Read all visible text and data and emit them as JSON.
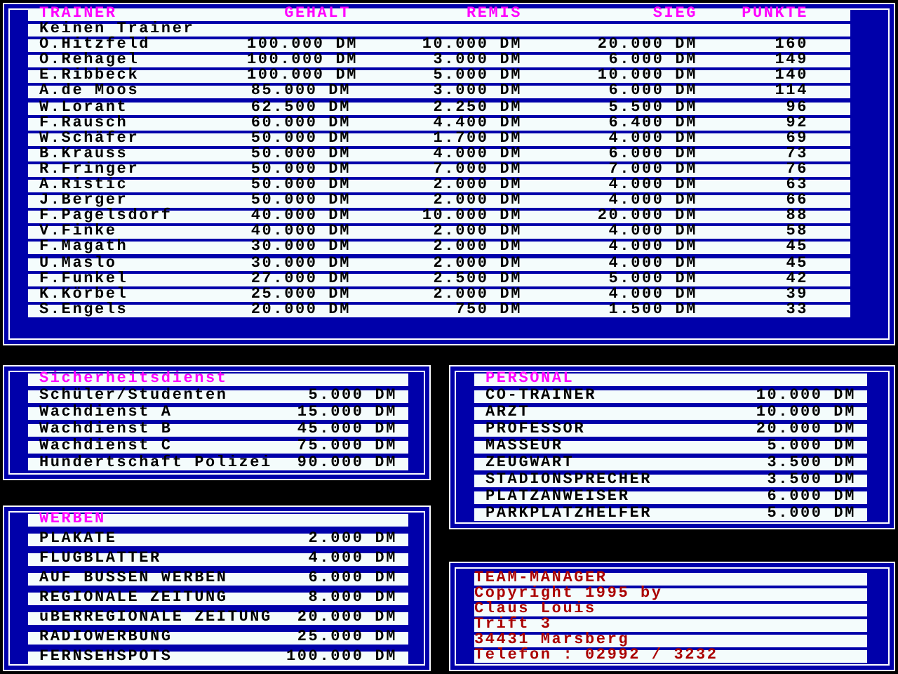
{
  "trainer_table": {
    "columns": [
      "TRAINER",
      "GEHALT",
      "REMIS",
      "SIEG",
      "PUNKTE"
    ],
    "rows": [
      {
        "cells": [
          "Keinen Trainer"
        ]
      },
      {
        "cells": [
          "O.Hitzfeld",
          "100.000 DM",
          "10.000 DM",
          "20.000 DM",
          "160"
        ]
      },
      {
        "cells": [
          "O.Rehagel",
          "100.000 DM",
          "3.000 DM",
          "6.000 DM",
          "149"
        ]
      },
      {
        "cells": [
          "E.Ribbeck",
          "100.000 DM",
          "5.000 DM",
          "10.000 DM",
          "140"
        ]
      },
      {
        "cells": [
          "A.de Moos",
          "85.000 DM",
          "3.000 DM",
          "6.000 DM",
          "114"
        ]
      },
      {
        "cells": [
          "W.Lorant",
          "62.500 DM",
          "2.250 DM",
          "5.500 DM",
          "96"
        ]
      },
      {
        "cells": [
          "F.Rausch",
          "60.000 DM",
          "4.400 DM",
          "6.400 DM",
          "92"
        ]
      },
      {
        "cells": [
          "W.Schäfer",
          "50.000 DM",
          "1.700 DM",
          "4.000 DM",
          "69"
        ]
      },
      {
        "cells": [
          "B.Krauss",
          "50.000 DM",
          "4.000 DM",
          "6.000 DM",
          "73"
        ]
      },
      {
        "cells": [
          "R.Fringer",
          "50.000 DM",
          "7.000 DM",
          "7.000 DM",
          "76"
        ]
      },
      {
        "cells": [
          "A.Ristic",
          "50.000 DM",
          "2.000 DM",
          "4.000 DM",
          "63"
        ]
      },
      {
        "cells": [
          "J.Berger",
          "50.000 DM",
          "2.000 DM",
          "4.000 DM",
          "66"
        ]
      },
      {
        "cells": [
          "F.Pagelsdorf",
          "40.000 DM",
          "10.000 DM",
          "20.000 DM",
          "88"
        ]
      },
      {
        "cells": [
          "V.Finke",
          "40.000 DM",
          "2.000 DM",
          "4.000 DM",
          "58"
        ]
      },
      {
        "cells": [
          "F.Magath",
          "30.000 DM",
          "2.000 DM",
          "4.000 DM",
          "45"
        ]
      },
      {
        "cells": [
          "U.Maslo",
          "30.000 DM",
          "2.000 DM",
          "4.000 DM",
          "45"
        ]
      },
      {
        "cells": [
          "F.Funkel",
          "27.000 DM",
          "2.500 DM",
          "5.000 DM",
          "42"
        ]
      },
      {
        "cells": [
          "K.Körbel",
          "25.000 DM",
          "2.000 DM",
          "4.000 DM",
          "39"
        ]
      },
      {
        "cells": [
          "S.Engels",
          "20.000 DM",
          "750 DM",
          "1.500 DM",
          "33"
        ]
      }
    ]
  },
  "sicherheitsdienst": {
    "title": "Sicherheitsdienst",
    "items": [
      {
        "label": "Schüler/Studenten",
        "price": "5.000 DM"
      },
      {
        "label": "Wachdienst A",
        "price": "15.000 DM"
      },
      {
        "label": "Wachdienst B",
        "price": "45.000 DM"
      },
      {
        "label": "Wachdienst C",
        "price": "75.000 DM"
      },
      {
        "label": "Hundertschaft Polizei",
        "price": "90.000 DM"
      }
    ]
  },
  "werben": {
    "title": "WERBEN",
    "items": [
      {
        "label": "PLAKATE",
        "price": "2.000 DM"
      },
      {
        "label": "FLUGBLATTER",
        "price": "4.000 DM"
      },
      {
        "label": "AUF BUSSEN WERBEN",
        "price": "6.000 DM"
      },
      {
        "label": "REGIONALE ZEITUNG",
        "price": "8.000 DM"
      },
      {
        "label": "uBERREGIONALE ZEITUNG",
        "price": "20.000 DM"
      },
      {
        "label": "RADIOWERBUNG",
        "price": "25.000 DM"
      },
      {
        "label": "FERNSEHSPOTS",
        "price": "100.000 DM"
      }
    ]
  },
  "personal": {
    "title": "PERSONAL",
    "items": [
      {
        "label": "CO-TRAINER",
        "price": "10.000 DM"
      },
      {
        "label": "ARZT",
        "price": "10.000 DM"
      },
      {
        "label": "PROFESSOR",
        "price": "20.000 DM"
      },
      {
        "label": "MASSEUR",
        "price": "5.000 DM"
      },
      {
        "label": "ZEUGWART",
        "price": "3.500 DM"
      },
      {
        "label": "STADIONSPRECHER",
        "price": "3.500 DM"
      },
      {
        "label": "PLATZANWEISER",
        "price": "6.000 DM"
      },
      {
        "label": "PARKPLATZHELFER",
        "price": "5.000 DM"
      }
    ]
  },
  "credits": {
    "lines": [
      "TEAM-MANAGER",
      "Copyright 1995 by",
      "Claus Louis",
      "Trift 3",
      "34431 Marsberg",
      "Telefon : 02992 / 3232"
    ]
  }
}
